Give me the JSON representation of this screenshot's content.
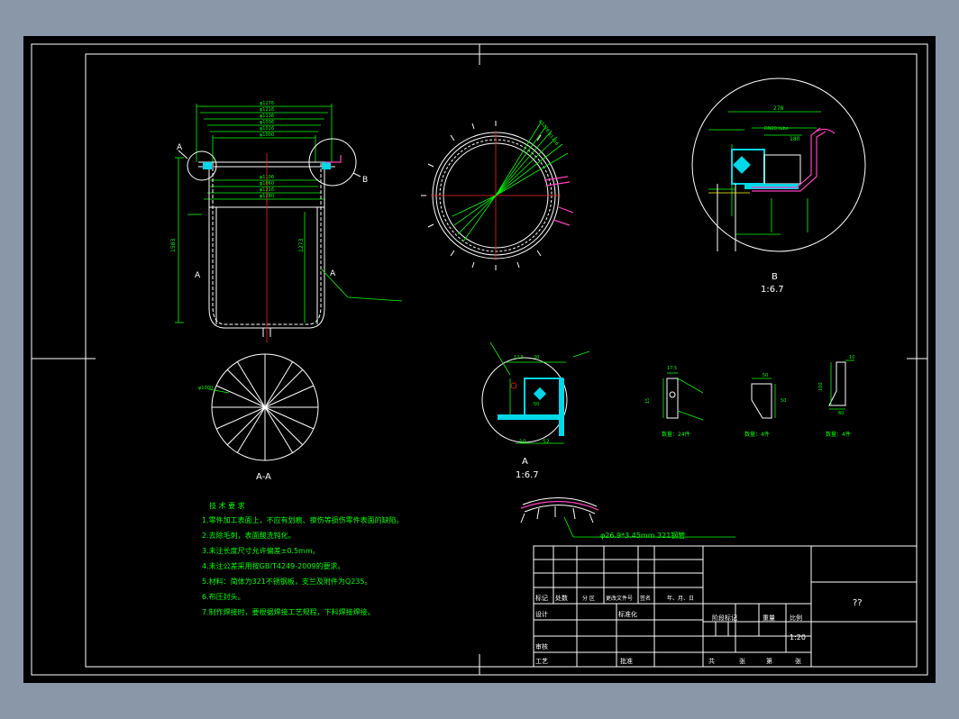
{
  "colors": {
    "background": "#8a97a8",
    "sheet": "#000000",
    "frame": "#ffffff",
    "dimension": "#00ff00",
    "centerline": "#ff2020",
    "weld": "#00d8e8",
    "pipe": "#ff40c0"
  },
  "views": {
    "section_aa": "A-A",
    "detail_a_label": "A",
    "detail_a_scale": "1:6.7",
    "detail_b_label": "B",
    "detail_b_scale": "1:6.7",
    "marker_a": "A",
    "marker_b": "B"
  },
  "dims": {
    "top": [
      "φ1276",
      "φ1216",
      "φ1136",
      "φ1036",
      "φ1016",
      "φ1000"
    ],
    "mid": [
      "φ1106",
      "φ1060",
      "φ1216",
      "φ1280"
    ],
    "height_left": "1583",
    "height_right": "1273",
    "bottom_dia": "φ1000",
    "b_width": "278",
    "b_180": "180",
    "b_pipe": "DN20 tube",
    "a_dims": [
      "12.5",
      "20",
      "50",
      "10",
      "52"
    ],
    "parts": [
      "17.5",
      "15",
      "50",
      "50",
      "100",
      "10",
      "60"
    ]
  },
  "parts_qty": [
    "数量：24件",
    "数量：4件",
    "数量：4件"
  ],
  "pipe_label": "φ26.9*3.45mm    321钢管",
  "tech": {
    "title": "技 术 要 求",
    "items": [
      "1.零件加工表面上，不应有划痕、擦伤等损伤零件表面的缺陷。",
      "2.去除毛刺，表面酸洗钝化。",
      "3.未注长度尺寸允许偏差±0.5mm。",
      "4.未注公差采用按GB/T4249-2009的要求。",
      "5.材料：简体为321不锈钢板，支兰及附件为Q235。",
      "6.布压封头。",
      "7.制作焊接时，要根据焊接工艺规程，下料焊接焊接。"
    ]
  },
  "title_block": {
    "row_labels": [
      "标记",
      "处数",
      "分 区",
      "更改文件号",
      "签名",
      "年、月、日"
    ],
    "design": "设计",
    "standard": "标准化",
    "review": "审核",
    "process": "工艺",
    "approve": "批准",
    "stage": "阶段标记",
    "weight": "重量",
    "scale_label": "比例",
    "scale": "1:20",
    "sheets": [
      "共",
      "张",
      "第",
      "张"
    ],
    "drawing_name": "??"
  }
}
